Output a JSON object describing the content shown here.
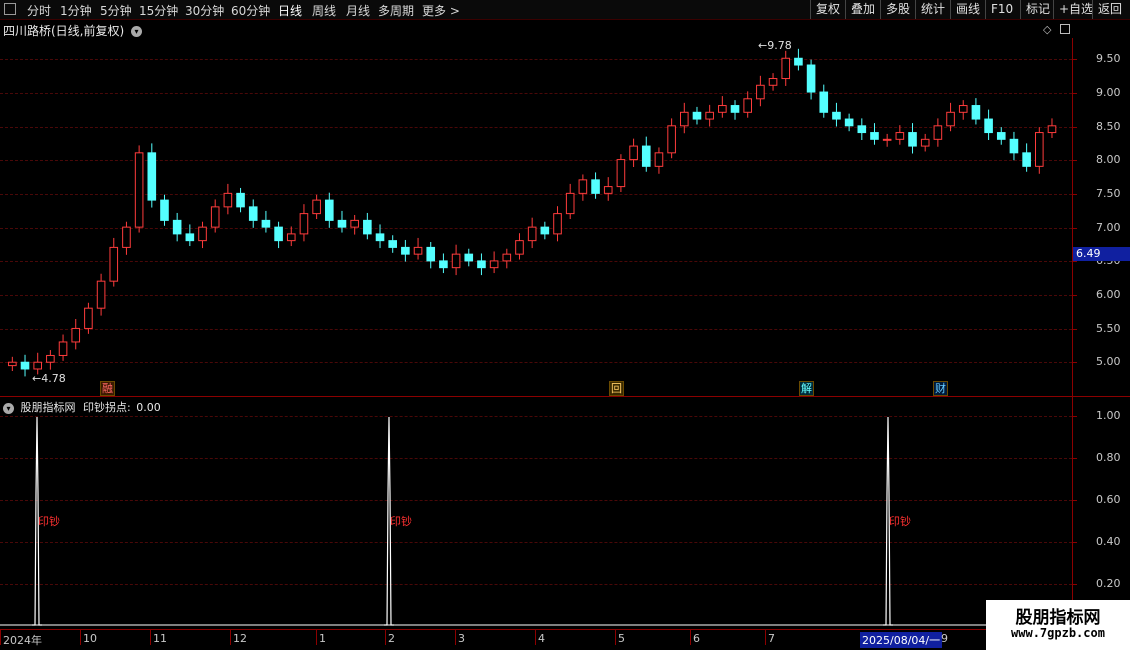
{
  "toolbar": {
    "left_items": [
      "分时",
      "1分钟",
      "5分钟",
      "15分钟",
      "30分钟",
      "60分钟",
      "日线",
      "周线",
      "月线",
      "多周期",
      "更多"
    ],
    "more_arrow": ">",
    "right_items": [
      "复权",
      "叠加",
      "多股",
      "统计",
      "画线",
      "F10",
      "标记",
      "+自选",
      "返回"
    ]
  },
  "main_panel": {
    "title": "四川路桥(日线,前复权)",
    "price_ticks": [
      "9.50",
      "9.00",
      "8.50",
      "8.00",
      "7.50",
      "7.00",
      "6.50",
      "6.00",
      "5.50",
      "5.00"
    ],
    "current_price": "6.49",
    "high_label": "9.78",
    "low_label": "4.78",
    "event_tags": [
      "融",
      "回",
      "解",
      "财"
    ]
  },
  "indicator_panel": {
    "title": "股朋指标网",
    "indicator_name": "印钞拐点:",
    "indicator_value": "0.00",
    "ticks": [
      "1.00",
      "0.80",
      "0.60",
      "0.40",
      "0.20"
    ],
    "signal_text": "印钞"
  },
  "x_axis": {
    "labels": [
      "2024年",
      "10",
      "11",
      "12",
      "1",
      "2",
      "3",
      "4",
      "5",
      "6",
      "7",
      "2025/08/04/一",
      "9"
    ]
  },
  "watermark": {
    "title": "股朋指标网",
    "url": "www.7gpzb.com"
  },
  "colors": {
    "up": "#ff3c3c",
    "down": "#54ffff",
    "axis": "#8b0000",
    "highlight_bg": "#1020a0"
  },
  "chart_data": {
    "type": "candlestick",
    "ylim": [
      4.6,
      9.9
    ],
    "candles_close": [
      5.1,
      5.0,
      5.1,
      5.2,
      5.4,
      5.6,
      5.9,
      6.3,
      6.8,
      7.1,
      8.2,
      7.5,
      7.2,
      7.0,
      6.9,
      7.1,
      7.4,
      7.6,
      7.4,
      7.2,
      7.1,
      6.9,
      7.0,
      7.3,
      7.5,
      7.2,
      7.1,
      7.2,
      7.0,
      6.9,
      6.8,
      6.7,
      6.8,
      6.6,
      6.5,
      6.7,
      6.6,
      6.5,
      6.6,
      6.7,
      6.9,
      7.1,
      7.0,
      7.3,
      7.6,
      7.8,
      7.6,
      7.7,
      8.1,
      8.3,
      8.0,
      8.2,
      8.6,
      8.8,
      8.7,
      8.8,
      8.9,
      8.8,
      9.0,
      9.2,
      9.3,
      9.6,
      9.5,
      9.1,
      8.8,
      8.7,
      8.6,
      8.5,
      8.4,
      8.4,
      8.5,
      8.3,
      8.4,
      8.6,
      8.8,
      8.9,
      8.7,
      8.5,
      8.4,
      8.2,
      8.0,
      8.5,
      8.6
    ],
    "indicator_signals": [
      1,
      0,
      0,
      1,
      0,
      0,
      1
    ]
  }
}
